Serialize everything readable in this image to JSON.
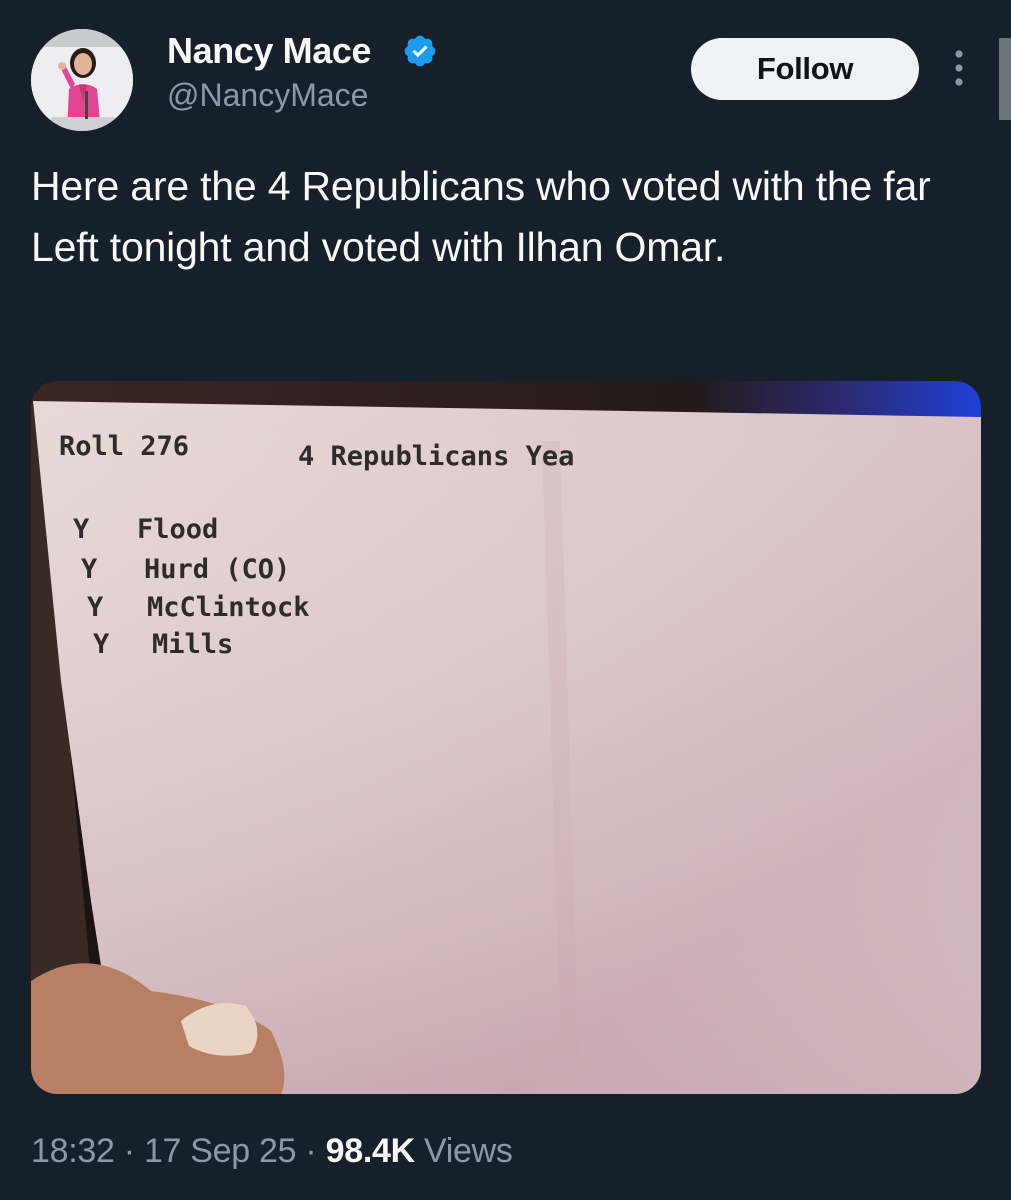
{
  "tweet": {
    "author": {
      "display_name": "Nancy Mace",
      "handle": "@NancyMace",
      "verified_icon": "verified-badge-icon",
      "verified_color": "#1d9bf0"
    },
    "follow_label": "Follow",
    "text": "Here are the 4 Republicans who voted with the far Left tonight and voted with Ilhan Omar.",
    "meta": {
      "time": "18:32",
      "separator": "·",
      "date": "17 Sep 25",
      "views_count": "98.4K",
      "views_label": "Views"
    }
  },
  "photo": {
    "roll": "Roll 276",
    "heading": "4 Republicans Yea",
    "votes": [
      {
        "vote": "Y",
        "name": "Flood"
      },
      {
        "vote": "Y",
        "name": "Hurd (CO)"
      },
      {
        "vote": "Y",
        "name": "McClintock"
      },
      {
        "vote": "Y",
        "name": "Mills"
      }
    ]
  },
  "colors": {
    "background": "#15202b",
    "text_primary": "#f7f9f9",
    "text_secondary": "#8b98a5",
    "follow_button": "#eff3f4"
  }
}
